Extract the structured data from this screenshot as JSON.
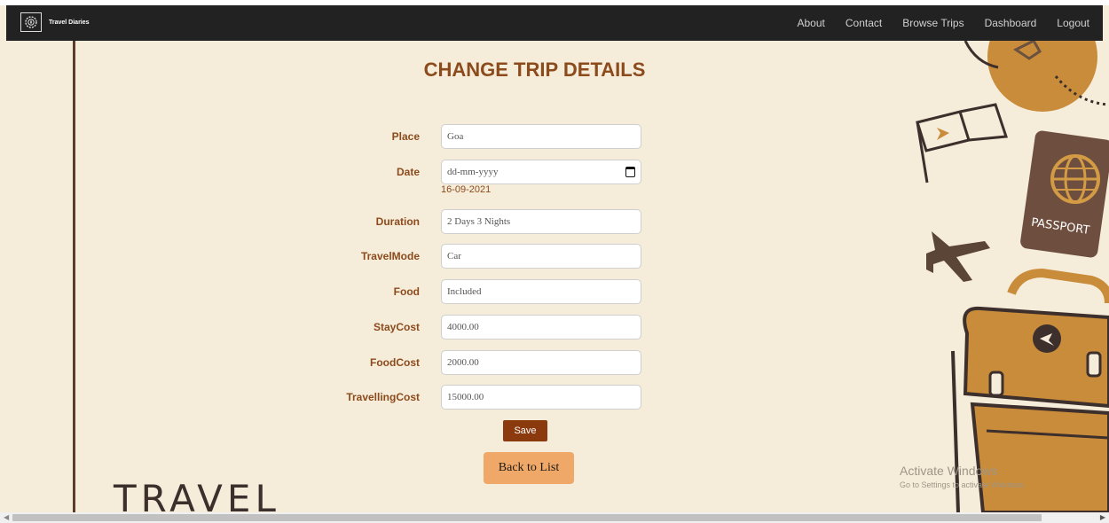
{
  "navbar": {
    "brand_text": "Travel Diaries",
    "links": [
      "About",
      "Contact",
      "Browse Trips",
      "Dashboard",
      "Logout"
    ]
  },
  "page": {
    "title": "CHANGE TRIP DETAILS"
  },
  "form": {
    "place": {
      "label": "Place",
      "value": "Goa"
    },
    "date": {
      "label": "Date",
      "placeholder": "dd-mm-yyyy",
      "current": "16-09-2021"
    },
    "duration": {
      "label": "Duration",
      "value": "2 Days 3 Nights"
    },
    "travel_mode": {
      "label": "TravelMode",
      "value": "Car"
    },
    "food": {
      "label": "Food",
      "value": "Included"
    },
    "stay_cost": {
      "label": "StayCost",
      "value": "4000.00"
    },
    "food_cost": {
      "label": "FoodCost",
      "value": "2000.00"
    },
    "travelling_cost": {
      "label": "TravellingCost",
      "value": "15000.00"
    },
    "save_label": "Save",
    "back_label": "Back to List"
  },
  "decor": {
    "travel_word": "TRAVEL",
    "passport_text": "PASSPORT"
  },
  "watermark": {
    "title": "Activate Windows",
    "subtitle": "Go to Settings to activate Windows."
  },
  "colors": {
    "accent": "#8b4b1c",
    "background": "#f6ecda",
    "save": "#8b3a0e",
    "back": "#f0a868",
    "navbar": "#222222"
  }
}
